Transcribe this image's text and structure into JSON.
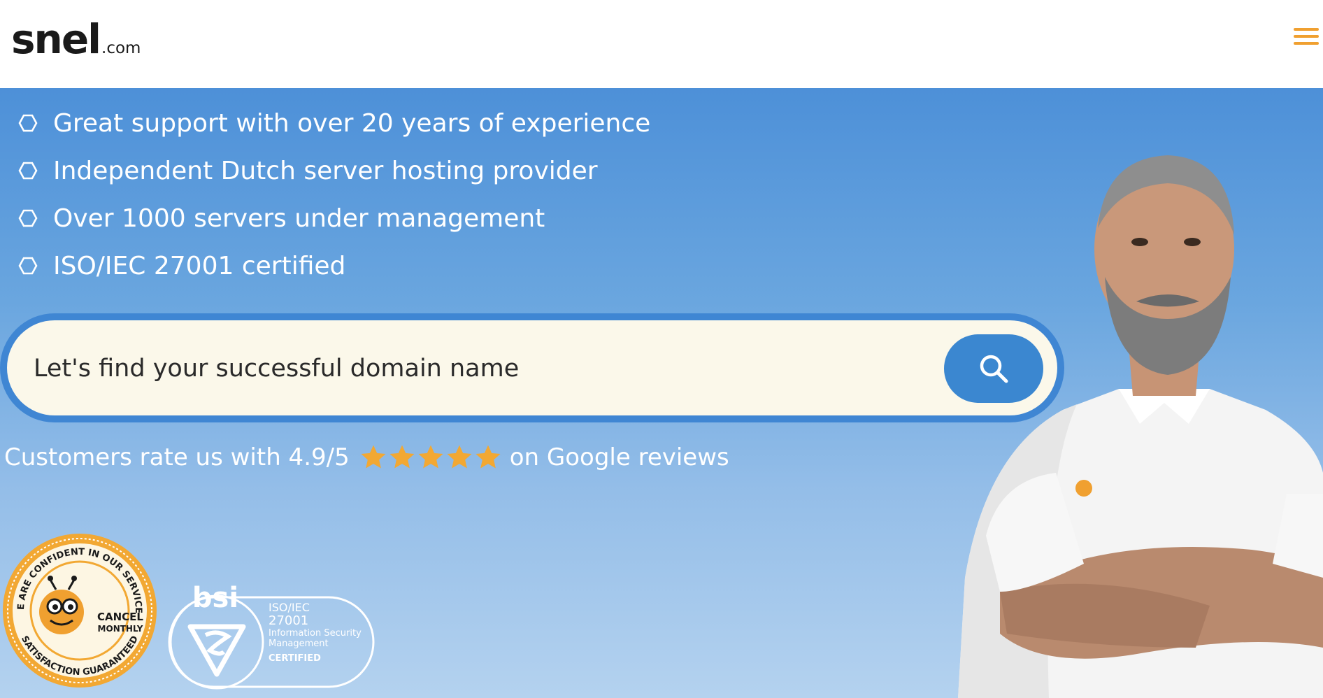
{
  "header": {
    "logo_main": "snel",
    "logo_tld": ".com",
    "menu_icon": "hamburger-menu-icon"
  },
  "hero": {
    "features": [
      "Great support with over 20 years of experience",
      "Independent Dutch server hosting provider",
      "Over 1000 servers under management",
      "ISO/IEC 27001 certified"
    ],
    "search": {
      "placeholder": "Let's find your successful domain name",
      "button_icon": "search-icon"
    },
    "rating": {
      "prefix": "Customers rate us with 4.9/5",
      "stars": 5,
      "suffix": "on Google reviews"
    },
    "badges": {
      "cancel_top": "WE ARE CONFIDENT IN OUR SERVICES",
      "cancel_bottom": "SATISFACTION GUARANTEED",
      "cancel_center_1": "CANCEL",
      "cancel_center_2": "MONTHLY",
      "bsi_logo": "bsi",
      "bsi_line1": "ISO/IEC",
      "bsi_line2": "27001",
      "bsi_line3": "Information Security",
      "bsi_line4": "Management",
      "bsi_line5": "CERTIFIED"
    }
  },
  "colors": {
    "accent": "#f0a030",
    "hero_top": "#4d90d8",
    "hero_bottom": "#b4d2ef",
    "search_border": "#3f86d3",
    "search_bg": "#fbf8ea",
    "star": "#f2a833"
  }
}
